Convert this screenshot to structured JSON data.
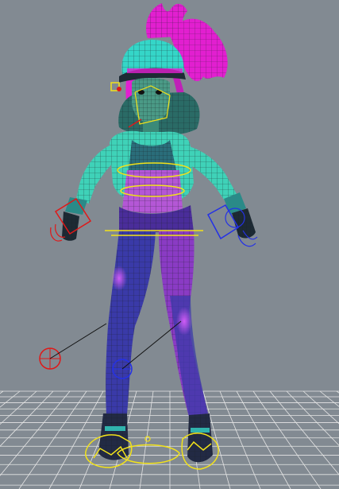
{
  "viewport": {
    "background": "#828a92",
    "grid_color": "#e6e6e6",
    "wireframe_color": "#1b1f24"
  },
  "character": {
    "hair_color": "#e21fd0",
    "cap_color": "#35d6c8",
    "jacket_color": "#3fd2b8",
    "top_color": "#b457d6",
    "leggings_color": "#3a3aa8",
    "legging_highlight": "#8a3bc4",
    "shoes_color": "#222a44",
    "skin_color": "#4a9a86"
  },
  "rig": {
    "left_control_color": "#e01818",
    "right_control_color": "#2431e6",
    "spine_control_color": "#f2e21a",
    "pole_line_color": "#111111",
    "foot_gear_color": "#f2e21a"
  }
}
